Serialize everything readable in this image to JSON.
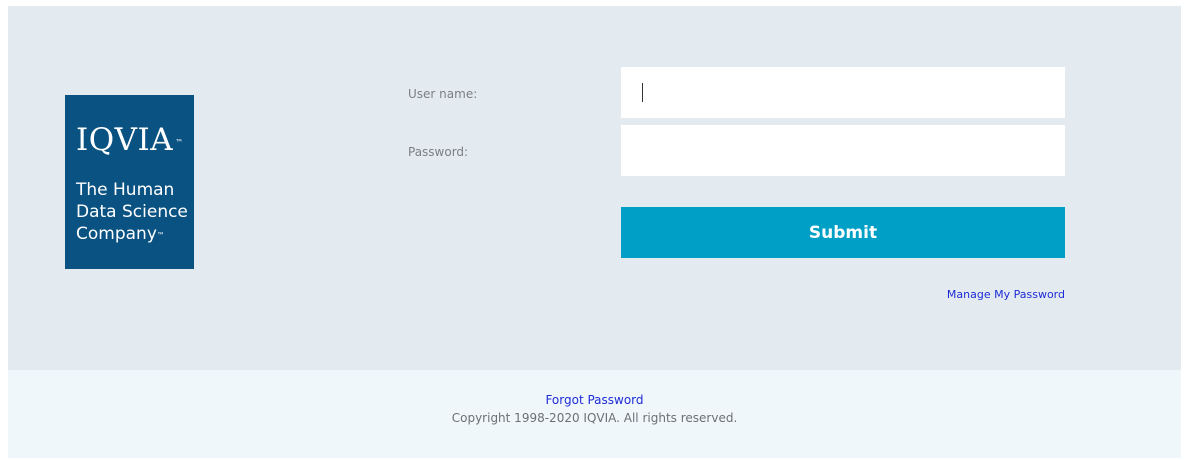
{
  "logo": {
    "wordmark": "IQVIA",
    "trademark": "™",
    "tagline_lines": [
      "The Human",
      "Data Science",
      "Company"
    ],
    "tagline_trademark": "™",
    "background_color": "#0a5282"
  },
  "form": {
    "username_label": "User name:",
    "username_value": "",
    "password_label": "Password:",
    "password_value": "",
    "submit_label": "Submit",
    "submit_color": "#009fc6",
    "manage_password_label": "Manage My Password"
  },
  "footer": {
    "forgot_password_label": "Forgot Password",
    "copyright": "Copyright 1998-2020 IQVIA. All rights reserved."
  },
  "colors": {
    "main_background": "#e3ebf0",
    "footer_background": "#f0f7fb",
    "link_color": "#1d2bd6"
  }
}
